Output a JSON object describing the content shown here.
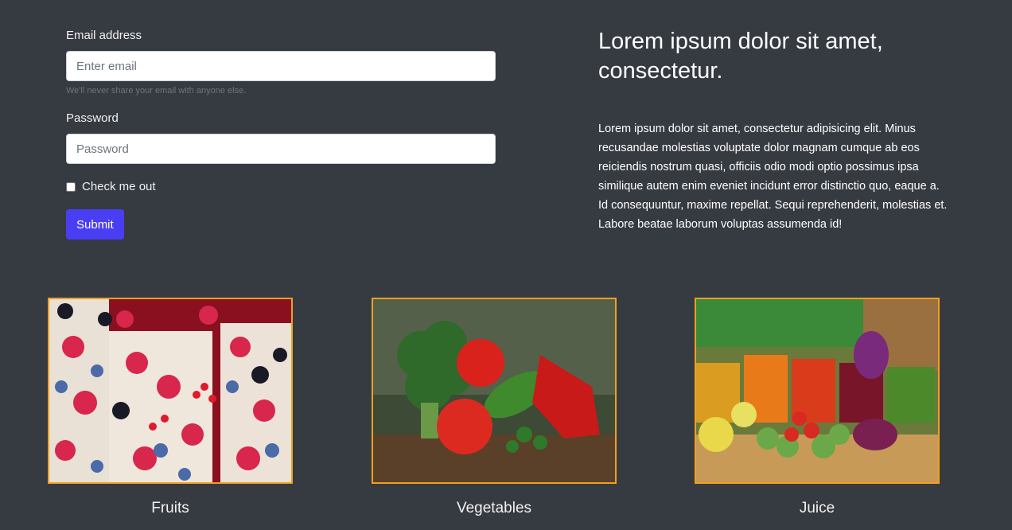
{
  "form": {
    "email_label": "Email address",
    "email_placeholder": "Enter email",
    "email_help": "We'll never share your email with anyone else.",
    "password_label": "Password",
    "password_placeholder": "Password",
    "check_label": "Check me out",
    "submit_label": "Submit"
  },
  "content": {
    "heading": "Lorem ipsum dolor sit amet, consectetur.",
    "paragraph": "Lorem ipsum dolor sit amet, consectetur adipisicing elit. Minus recusandae molestias voluptate dolor magnam cumque ab eos reiciendis nostrum quasi, officiis odio modi optio possimus ipsa similique autem enim eveniet incidunt error distinctio quo, eaque a. Id consequuntur, maxime repellat. Sequi reprehenderit, molestias et. Labore beatae laborum voluptas assumenda id!"
  },
  "cards": [
    {
      "caption": "Fruits",
      "image": "berries-photo"
    },
    {
      "caption": "Vegetables",
      "image": "vegetables-photo"
    },
    {
      "caption": "Juice",
      "image": "juice-photo"
    }
  ],
  "colors": {
    "background": "#363a41",
    "button": "#4a3ef5",
    "image_border": "#f0a020"
  }
}
